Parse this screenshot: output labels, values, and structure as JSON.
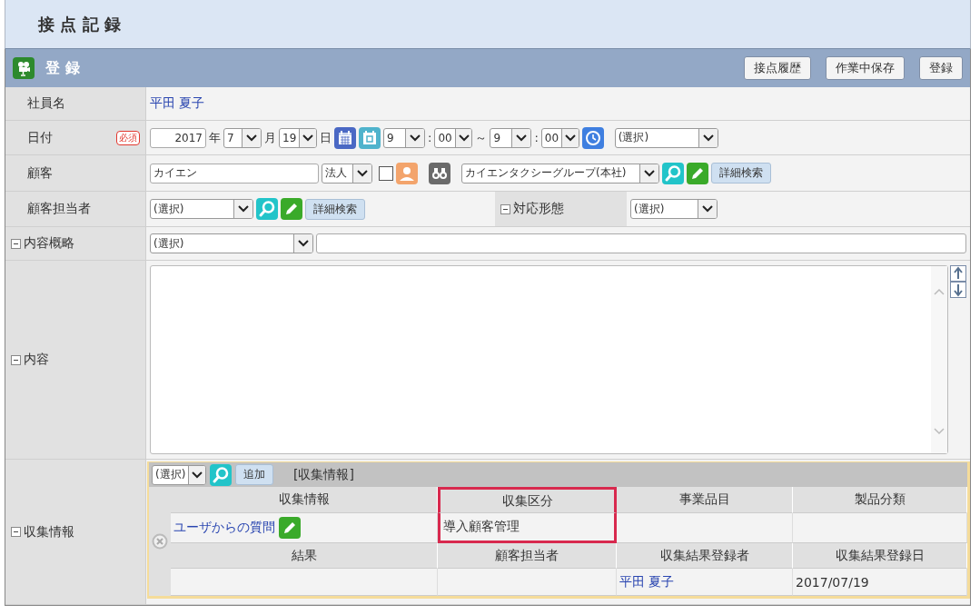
{
  "page_title": "接 点 記 録",
  "section": {
    "title": "登 録",
    "buttons": [
      "接点履歴",
      "作業中保存",
      "登録"
    ]
  },
  "employee": {
    "label": "社員名",
    "value": "平田 夏子"
  },
  "date": {
    "label": "日付",
    "required_badge": "必須",
    "year": "2017",
    "year_unit": "年",
    "month": "7",
    "month_unit": "月",
    "day": "19",
    "day_unit": "日",
    "start_time": {
      "hour": "9",
      "separator": ":",
      "minute": "00"
    },
    "range_separator": "～",
    "end_time": {
      "hour": "9",
      "separator": ":",
      "minute": "00"
    },
    "time_slot": "(選択)"
  },
  "customer": {
    "label": "顧客",
    "name": "カイエン",
    "type": "法人",
    "checked": false,
    "company": "カイエンタクシーグループ(本社)",
    "detail_search": "詳細検索"
  },
  "contact": {
    "label": "顧客担当者",
    "value": "(選択)",
    "detail_search": "詳細検索",
    "method_label": "対応形態",
    "method_expanded": true,
    "method_value": "(選択)"
  },
  "summary": {
    "label": "内容概略",
    "expanded": true,
    "value": "(選択)"
  },
  "content": {
    "label": "内容",
    "expanded": true
  },
  "collection": {
    "label": "収集情報",
    "expanded": true,
    "select": "(選択)",
    "add_button": "追加",
    "caption": "[収集情報]",
    "upper_columns": [
      {
        "header": "収集情報",
        "kind": "link_edit",
        "value": "ユーザからの質問",
        "highlighted": false
      },
      {
        "header": "収集区分",
        "kind": "text",
        "value": "導入顧客管理",
        "highlighted": true
      },
      {
        "header": "事業品目",
        "kind": "empty",
        "highlighted": false
      },
      {
        "header": "製品分類",
        "kind": "empty",
        "highlighted": false
      }
    ],
    "lower_columns": [
      {
        "header": "結果",
        "kind": "empty",
        "highlighted": false
      },
      {
        "header": "顧客担当者",
        "kind": "empty",
        "highlighted": false
      },
      {
        "header": "収集結果登録者",
        "kind": "link",
        "value": "平田 夏子",
        "highlighted": false
      },
      {
        "header": "収集結果登録日",
        "kind": "text",
        "value": "2017/07/19",
        "highlighted": false
      }
    ]
  }
}
